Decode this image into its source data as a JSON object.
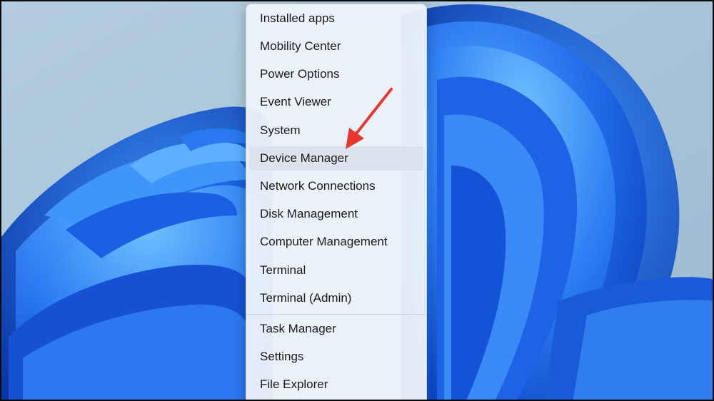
{
  "context_menu": {
    "items": [
      {
        "label": "Installed apps"
      },
      {
        "label": "Mobility Center"
      },
      {
        "label": "Power Options"
      },
      {
        "label": "Event Viewer"
      },
      {
        "label": "System"
      },
      {
        "label": "Device Manager",
        "highlighted": true
      },
      {
        "label": "Network Connections"
      },
      {
        "label": "Disk Management"
      },
      {
        "label": "Computer Management"
      },
      {
        "label": "Terminal"
      },
      {
        "label": "Terminal (Admin)"
      },
      {
        "label": "Task Manager"
      },
      {
        "label": "Settings"
      },
      {
        "label": "File Explorer"
      }
    ]
  },
  "annotation": {
    "arrow_color": "#e8372e",
    "points_to": "Device Manager"
  },
  "colors": {
    "wallpaper_bg": "#a9c3d8",
    "bloom_blue": "#1a5fe0",
    "menu_bg": "#ecf2fa",
    "highlight": "#dce3ec"
  }
}
